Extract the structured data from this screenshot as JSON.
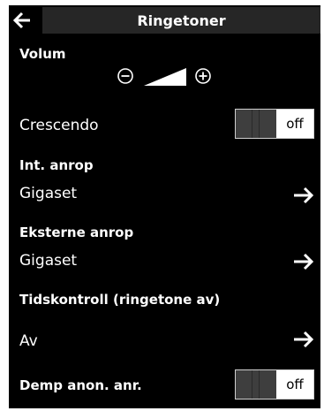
{
  "header": {
    "title": "Ringetoner",
    "back_icon": "arrow-left-icon"
  },
  "volume": {
    "label": "Volum",
    "level": 0.6,
    "decrease_icon": "minus-circle-icon",
    "increase_icon": "plus-circle-icon"
  },
  "crescendo": {
    "label": "Crescendo",
    "state": "off"
  },
  "internal_calls": {
    "label": "Int. anrop",
    "value": "Gigaset"
  },
  "external_calls": {
    "label": "Eksterne anrop",
    "value": "Gigaset"
  },
  "time_control": {
    "label": "Tidskontroll (ringetone av)",
    "value": "Av"
  },
  "suppress_anonymous": {
    "label": "Demp anon. anr.",
    "state": "off"
  },
  "colors": {
    "background": "#000000",
    "header": "#262626",
    "text": "#ffffff",
    "toggle_knob": "#3e3e3e"
  }
}
